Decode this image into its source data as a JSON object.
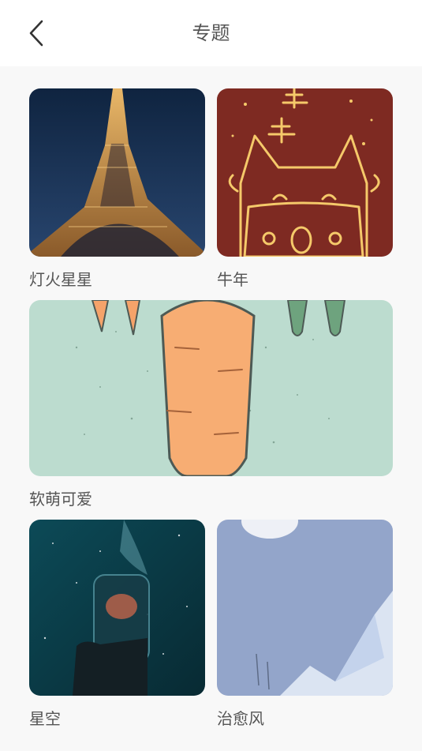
{
  "header": {
    "title": "专题",
    "back_icon": "chevron-left-icon"
  },
  "topics": [
    {
      "label": "灯火星星",
      "theme": "eiffel-tower-night"
    },
    {
      "label": "牛年",
      "theme": "ox-year-cartoon"
    },
    {
      "label": "软萌可爱",
      "theme": "carrot-illustration"
    },
    {
      "label": "星空",
      "theme": "galaxy-jar"
    },
    {
      "label": "治愈风",
      "theme": "moon-mountains"
    }
  ]
}
